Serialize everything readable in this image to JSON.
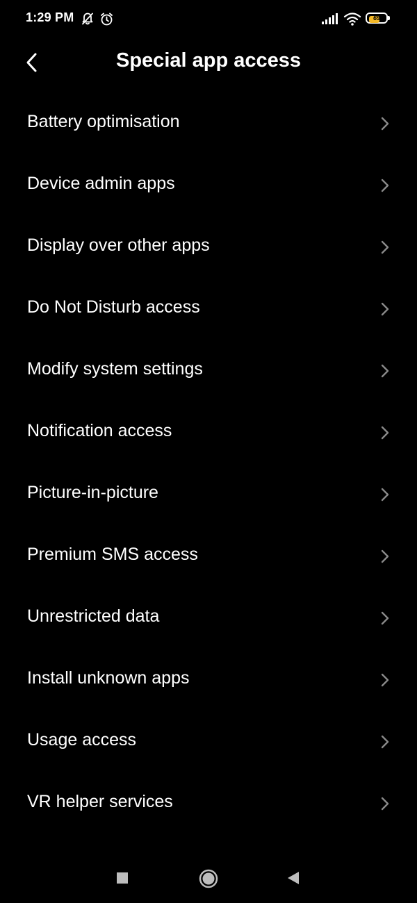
{
  "status_bar": {
    "time": "1:29 PM",
    "icons": [
      "notifications-off-icon",
      "alarm-icon",
      "signal-icon",
      "wifi-icon",
      "battery-icon"
    ],
    "battery_level": "69",
    "battery_color": "#f5b928"
  },
  "header": {
    "title": "Special app access",
    "back_icon": "back-arrow-icon"
  },
  "menu": {
    "items": [
      {
        "label": "Battery optimisation"
      },
      {
        "label": "Device admin apps"
      },
      {
        "label": "Display over other apps"
      },
      {
        "label": "Do Not Disturb access"
      },
      {
        "label": "Modify system settings"
      },
      {
        "label": "Notification access"
      },
      {
        "label": "Picture-in-picture"
      },
      {
        "label": "Premium SMS access"
      },
      {
        "label": "Unrestricted data"
      },
      {
        "label": "Install unknown apps"
      },
      {
        "label": "Usage access"
      },
      {
        "label": "VR helper services"
      }
    ],
    "chevron_icon": "chevron-right-icon"
  },
  "nav_bar": {
    "buttons": [
      "recents-button",
      "home-button",
      "back-button"
    ]
  },
  "colors": {
    "background": "#000000",
    "text": "#ffffff",
    "chevron": "#8a8a8a"
  }
}
